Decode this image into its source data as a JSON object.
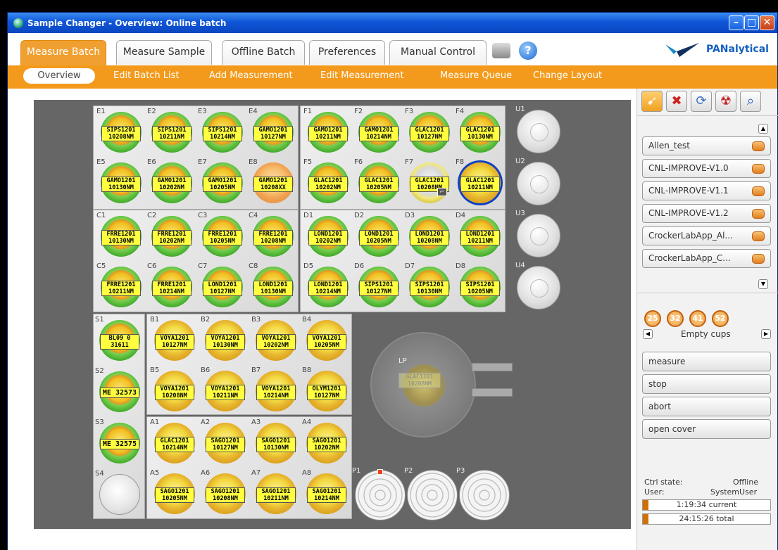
{
  "window": {
    "title": "Sample Changer - Overview: Online batch"
  },
  "tabs": [
    "Measure Batch",
    "Measure Sample",
    "Offline Batch",
    "Preferences",
    "Manual Control"
  ],
  "subnav": [
    "Overview",
    "Edit Batch List",
    "Add Measurement",
    "Edit Measurement",
    "Measure Queue",
    "Change Layout"
  ],
  "logo": {
    "text": "PANalytical"
  },
  "trays": {
    "E": [
      [
        "E1",
        "SIPS1201\n10208NM",
        "green"
      ],
      [
        "E2",
        "SIPS1201\n10211NM",
        "green"
      ],
      [
        "E3",
        "SIPS1201\n10214NM",
        "green"
      ],
      [
        "E4",
        "GAMO1201\n10127NM",
        "green"
      ],
      [
        "E5",
        "GAMO1201\n10130NM",
        "green"
      ],
      [
        "E6",
        "GAMO1201\n10202NM",
        "green"
      ],
      [
        "E7",
        "GAMO1201\n10205NM",
        "green"
      ],
      [
        "E8",
        "GAMO1201\n10208XX",
        "orange"
      ]
    ],
    "F": [
      [
        "F1",
        "GAMO1201\n10211NM",
        "green"
      ],
      [
        "F2",
        "GAMO1201\n10214NM",
        "green"
      ],
      [
        "F3",
        "GLAC1201\n10127NM",
        "green"
      ],
      [
        "F4",
        "GLAC1201\n10130NM",
        "green"
      ],
      [
        "F5",
        "GLAC1201\n10202NM",
        "green"
      ],
      [
        "F6",
        "GLAC1201\n10205NM",
        "green"
      ],
      [
        "F7",
        "GLAC1201\n10208NM",
        "gray"
      ],
      [
        "F8",
        "GLAC1201\n10211NM",
        "selected"
      ]
    ],
    "C": [
      [
        "C1",
        "FRRE1201\n10130NM",
        "green"
      ],
      [
        "C2",
        "FRRE1201\n10202NM",
        "green"
      ],
      [
        "C3",
        "FRRE1201\n10205NM",
        "green"
      ],
      [
        "C4",
        "FRRE1201\n10208NM",
        "green"
      ],
      [
        "C5",
        "FRRE1201\n10211NM",
        "green"
      ],
      [
        "C6",
        "FRRE1201\n10214NM",
        "green"
      ],
      [
        "C7",
        "LOND1201\n10127NM",
        "green"
      ],
      [
        "C8",
        "LOND1201\n10130NM",
        "green"
      ]
    ],
    "D": [
      [
        "D1",
        "LOND1201\n10202NM",
        "green"
      ],
      [
        "D2",
        "LOND1201\n10205NM",
        "green"
      ],
      [
        "D3",
        "LOND1201\n10208NM",
        "green"
      ],
      [
        "D4",
        "LOND1201\n10211NM",
        "green"
      ],
      [
        "D5",
        "LOND1201\n10214NM",
        "green"
      ],
      [
        "D6",
        "SIPS1201\n10127NM",
        "green"
      ],
      [
        "D7",
        "SIPS1201\n10130NM",
        "green"
      ],
      [
        "D8",
        "SIPS1201\n10205NM",
        "green"
      ]
    ],
    "B": [
      [
        "B1",
        "VOYA1201\n10127NM",
        "yellow"
      ],
      [
        "B2",
        "VOYA1201\n10130NM",
        "yellow"
      ],
      [
        "B3",
        "VOYA1201\n10202NM",
        "yellow"
      ],
      [
        "B4",
        "VOYA1201\n10205NM",
        "yellow"
      ],
      [
        "B5",
        "VOYA1201\n10208NM",
        "yellow"
      ],
      [
        "B6",
        "VOYA1201\n10211NM",
        "yellow"
      ],
      [
        "B7",
        "VOYA1201\n10214NM",
        "yellow"
      ],
      [
        "B8",
        "OLYM1201\n10127NM",
        "yellow"
      ]
    ],
    "A": [
      [
        "A1",
        "GLAC1201\n10214NM",
        "yellow"
      ],
      [
        "A2",
        "SAGO1201\n10127NM",
        "yellow"
      ],
      [
        "A3",
        "SAGO1201\n10130NM",
        "yellow"
      ],
      [
        "A4",
        "SAGO1201\n10202NM",
        "yellow"
      ],
      [
        "A5",
        "SAGO1201\n10205NM",
        "yellow"
      ],
      [
        "A6",
        "SAGO1201\n10208NM",
        "yellow"
      ],
      [
        "A7",
        "SAGO1201\n10211NM",
        "yellow"
      ],
      [
        "A8",
        "SAGO1201\n10214NM",
        "yellow"
      ]
    ],
    "S": [
      [
        "S1",
        "BL09 0\n31611",
        "green"
      ],
      [
        "S2",
        "ME 32573",
        "green"
      ],
      [
        "S3",
        "ME 32575",
        "green"
      ],
      [
        "S4",
        "",
        "empty"
      ]
    ]
  },
  "u_slots": [
    "U1",
    "U2",
    "U3",
    "U4"
  ],
  "p_slots": [
    "P1",
    "P2",
    "P3"
  ],
  "loading_position": {
    "label": "LP",
    "sample": "GLAC1201\n10208NM"
  },
  "batches": [
    "Allen_test",
    "CNL-IMPROVE-V1.0",
    "CNL-IMPROVE-V1.1",
    "CNL-IMPROVE-V1.2",
    "CrockerLabApp_Al...",
    "CrockerLabApp_C..."
  ],
  "empty_cups": {
    "sizes": [
      "25",
      "32",
      "41",
      "52"
    ],
    "label": "Empty cups"
  },
  "commands": [
    "measure",
    "stop",
    "abort",
    "open cover"
  ],
  "status": {
    "ctrl_label": "Ctrl state:",
    "ctrl_value": "Offline",
    "user_label": "User:",
    "user_value": "SystemUser",
    "current": "1:19:34 current",
    "total": "24:15:26 total"
  }
}
